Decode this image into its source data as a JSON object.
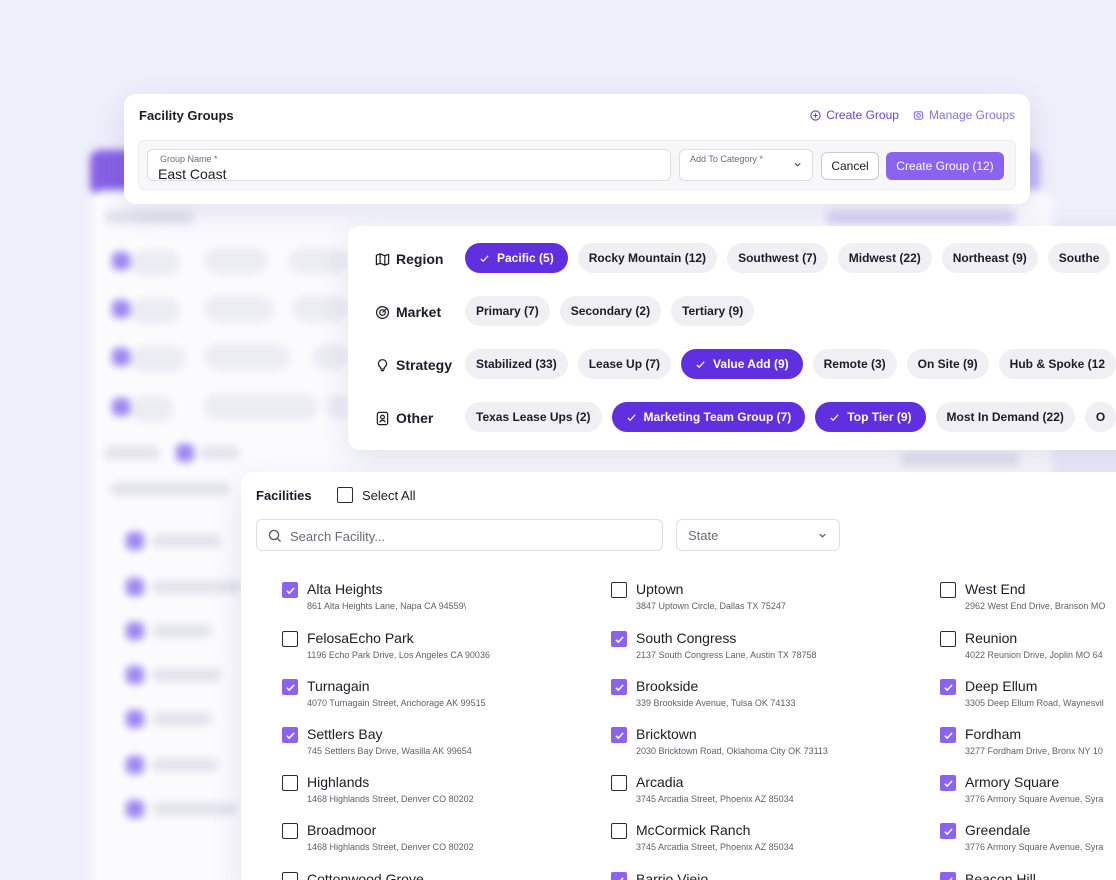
{
  "groups": {
    "title": "Facility Groups",
    "create_group_link": "Create Group",
    "manage_groups_link": "Manage Groups",
    "group_name_label": "Group Name *",
    "group_name_value": "East Coast",
    "category_label": "Add To Category *",
    "category_value": "",
    "cancel_label": "Cancel",
    "create_button_label": "Create Group (12)"
  },
  "filters": [
    {
      "label": "Region",
      "icon": "map-icon",
      "chips": [
        {
          "label": "Pacific (5)",
          "selected": true
        },
        {
          "label": "Rocky Mountain (12)",
          "selected": false
        },
        {
          "label": "Southwest (7)",
          "selected": false
        },
        {
          "label": "Midwest (22)",
          "selected": false
        },
        {
          "label": "Northeast (9)",
          "selected": false
        },
        {
          "label": "Southe",
          "selected": false
        }
      ]
    },
    {
      "label": "Market",
      "icon": "target-icon",
      "chips": [
        {
          "label": "Primary (7)",
          "selected": false
        },
        {
          "label": "Secondary (2)",
          "selected": false
        },
        {
          "label": "Tertiary (9)",
          "selected": false
        }
      ]
    },
    {
      "label": "Strategy",
      "icon": "lightbulb-icon",
      "chips": [
        {
          "label": "Stabilized (33)",
          "selected": false
        },
        {
          "label": "Lease Up (7)",
          "selected": false
        },
        {
          "label": "Value Add (9)",
          "selected": true
        },
        {
          "label": "Remote (3)",
          "selected": false
        },
        {
          "label": "On Site (9)",
          "selected": false
        },
        {
          "label": "Hub & Spoke (12",
          "selected": false
        }
      ]
    },
    {
      "label": "Other",
      "icon": "badge-icon",
      "chips": [
        {
          "label": "Texas Lease Ups (2)",
          "selected": false
        },
        {
          "label": "Marketing Team Group (7)",
          "selected": true
        },
        {
          "label": "Top Tier (9)",
          "selected": true
        },
        {
          "label": "Most In Demand (22)",
          "selected": false
        },
        {
          "label": "O",
          "selected": false
        }
      ]
    }
  ],
  "facilities": {
    "title": "Facilities",
    "select_all_label": "Select All",
    "search_placeholder": "Search Facility...",
    "state_placeholder": "State",
    "columns": [
      [
        {
          "name": "Alta Heights",
          "address": "861 Alta Heights Lane, Napa CA 94559\\",
          "checked": true
        },
        {
          "name": "FelosaEcho Park",
          "address": "1196 Echo Park Drive, Los Angeles CA 90036",
          "checked": false
        },
        {
          "name": "Turnagain",
          "address": "4070 Turnagain Street, Anchorage AK 99515",
          "checked": true
        },
        {
          "name": "Settlers Bay",
          "address": "745 Settlers Bay Drive, Wasilla AK 99654",
          "checked": true
        },
        {
          "name": "Highlands",
          "address": "1468 Highlands Street, Denver CO 80202",
          "checked": false
        },
        {
          "name": "Broadmoor",
          "address": "1468 Highlands Street, Denver CO 80202",
          "checked": false
        },
        {
          "name": "Cottonwood Grove",
          "address": "",
          "checked": false
        }
      ],
      [
        {
          "name": "Uptown",
          "address": "3847 Uptown Circle, Dallas TX 75247",
          "checked": false
        },
        {
          "name": "South Congress",
          "address": "2137 South Congress Lane, Austin TX 78758",
          "checked": true
        },
        {
          "name": "Brookside",
          "address": "339 Brookside Avenue, Tulsa OK 74133",
          "checked": true
        },
        {
          "name": "Bricktown",
          "address": "2030 Bricktown Road, Oklahoma City OK 73113",
          "checked": true
        },
        {
          "name": "Arcadia",
          "address": "3745 Arcadia Street, Phoenix AZ 85034",
          "checked": false
        },
        {
          "name": "McCormick Ranch",
          "address": "3745 Arcadia Street, Phoenix AZ 85034",
          "checked": false
        },
        {
          "name": "Barrio Viejo",
          "address": "",
          "checked": true
        }
      ],
      [
        {
          "name": "West End",
          "address": "2962 West End Drive, Branson MO",
          "checked": false
        },
        {
          "name": "Reunion",
          "address": "4022 Reunion Drive, Joplin MO 64",
          "checked": false
        },
        {
          "name": "Deep Ellum",
          "address": "3305 Deep Ellum Road, Waynesvil",
          "checked": true
        },
        {
          "name": "Fordham",
          "address": "3277 Fordham Drive, Bronx NY 10",
          "checked": true
        },
        {
          "name": "Armory Square",
          "address": "3776 Armory Square Avenue, Syra",
          "checked": true
        },
        {
          "name": "Greendale",
          "address": "3776 Armory Square Avenue, Syra",
          "checked": true
        },
        {
          "name": "Beacon Hill",
          "address": "",
          "checked": true
        }
      ]
    ]
  },
  "colors": {
    "accent": "#5f2fe0",
    "checkbox": "#8a63ef",
    "link": "#6a3fe0",
    "background": "#efeefb"
  }
}
